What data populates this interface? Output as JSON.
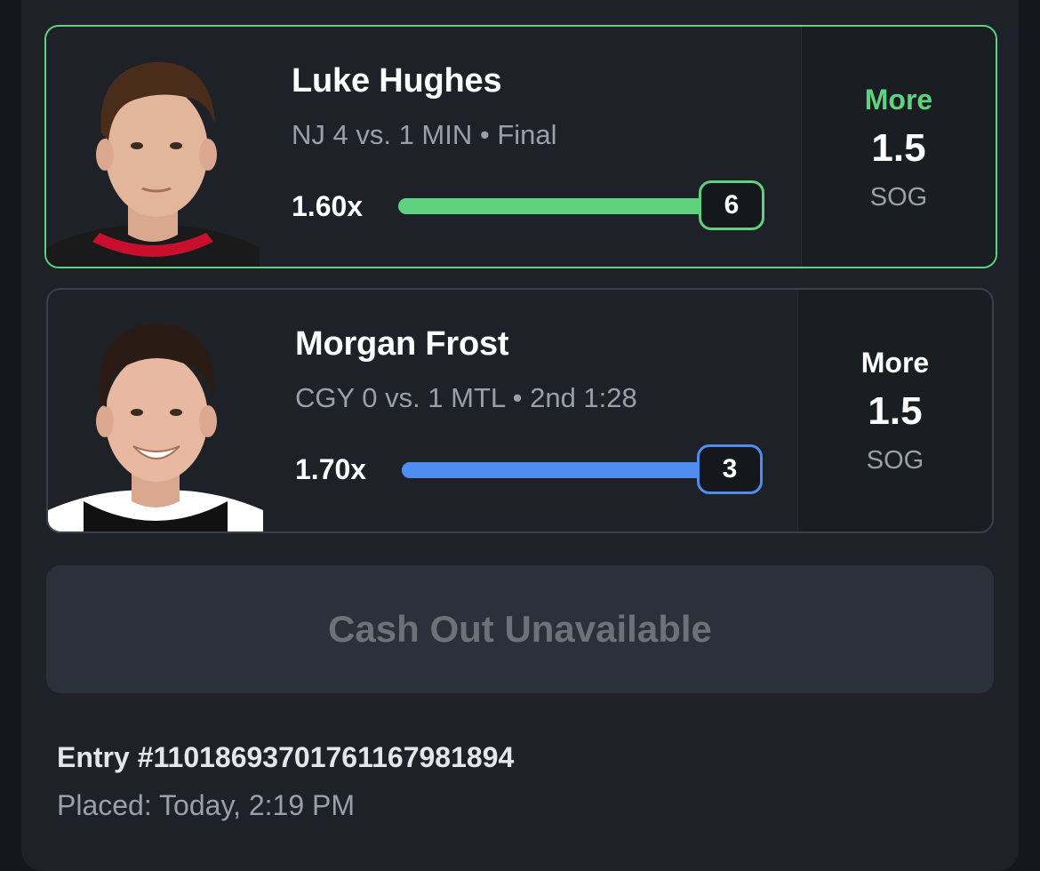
{
  "picks": [
    {
      "player_name": "Luke Hughes",
      "game_status": "NJ 4 vs. 1 MIN • Final",
      "multiplier": "1.60x",
      "current_stat": "6",
      "progress": 1.0,
      "progress_color": "#5fd27f",
      "result": "won",
      "direction": "More",
      "direction_color": "#5fd27f",
      "line": "1.5",
      "stat_type": "SOG",
      "jersey_color": "#c8102e"
    },
    {
      "player_name": "Morgan Frost",
      "game_status": "CGY 0 vs. 1 MTL • 2nd 1:28",
      "multiplier": "1.70x",
      "current_stat": "3",
      "progress": 1.0,
      "progress_color": "#4f8ef0",
      "result": "live",
      "direction": "More",
      "direction_color": "#ffffff",
      "line": "1.5",
      "stat_type": "SOG",
      "jersey_color": "#ffffff"
    }
  ],
  "cashout": {
    "label": "Cash Out Unavailable"
  },
  "entry": {
    "id_label": "Entry #1101869370176116798​1894",
    "placed_label": "Placed: Today, 2:19 PM"
  },
  "colors": {
    "background": "#1e2228",
    "card_border": "#3a404a",
    "won_border": "#5fd27f",
    "cashout_bg": "#2b313a",
    "cashout_text": "#6c727a"
  }
}
